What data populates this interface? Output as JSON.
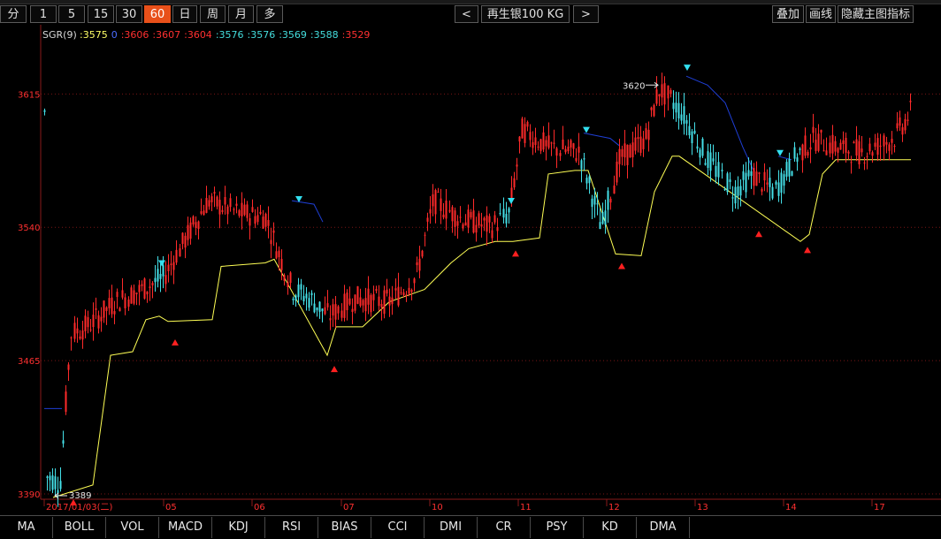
{
  "toolbar": {
    "periods": [
      {
        "label": "分"
      },
      {
        "label": "1"
      },
      {
        "label": "5"
      },
      {
        "label": "15"
      },
      {
        "label": "30"
      },
      {
        "label": "60",
        "active": true
      },
      {
        "label": "日"
      },
      {
        "label": "周"
      },
      {
        "label": "月"
      },
      {
        "label": "多"
      }
    ],
    "prev_label": "<",
    "title": "再生银100 KG",
    "next_label": ">",
    "right_buttons": [
      {
        "label": "叠加"
      },
      {
        "label": "画线"
      },
      {
        "label": "隐藏主图指标"
      }
    ]
  },
  "indicator": {
    "name": "SGR(9)",
    "values": [
      {
        "text": ":3575",
        "color": "#ffff66"
      },
      {
        "text": "0",
        "color": "#4a6cff"
      },
      {
        "text": ":3606",
        "color": "#ff3030"
      },
      {
        "text": ":3607",
        "color": "#ff3030"
      },
      {
        "text": ":3604",
        "color": "#ff3030"
      },
      {
        "text": ":3576",
        "color": "#44dddd"
      },
      {
        "text": ":3576",
        "color": "#44dddd"
      },
      {
        "text": ":3569",
        "color": "#44dddd"
      },
      {
        "text": ":3588",
        "color": "#44dddd"
      },
      {
        "text": ":3529",
        "color": "#ff3030"
      }
    ]
  },
  "chart_data": {
    "type": "candlestick",
    "y_ticks": [
      3615,
      3540,
      3465,
      3390
    ],
    "ylim": [
      3388,
      3645
    ],
    "x_labels": [
      "2017/01/03(二)",
      "05",
      "06",
      "07",
      "10",
      "11",
      "12",
      "13",
      "14",
      "17"
    ],
    "annotations": [
      {
        "text": "3620",
        "value": 3620
      },
      {
        "text": "3389",
        "value": 3389
      }
    ],
    "colors": {
      "up": "#ff2a2a",
      "down": "#44e0e8",
      "support": "#ffff55",
      "resistance": "#1f3fd6",
      "grid": "#7a1515",
      "axis": "#8a1a1a",
      "label": "#ff3030"
    }
  },
  "bottom_tabs": [
    {
      "label": "MA"
    },
    {
      "label": "BOLL"
    },
    {
      "label": "VOL"
    },
    {
      "label": "MACD"
    },
    {
      "label": "KDJ"
    },
    {
      "label": "RSI"
    },
    {
      "label": "BIAS"
    },
    {
      "label": "CCI"
    },
    {
      "label": "DMI"
    },
    {
      "label": "CR"
    },
    {
      "label": "PSY"
    },
    {
      "label": "KD"
    },
    {
      "label": "DMA"
    }
  ]
}
